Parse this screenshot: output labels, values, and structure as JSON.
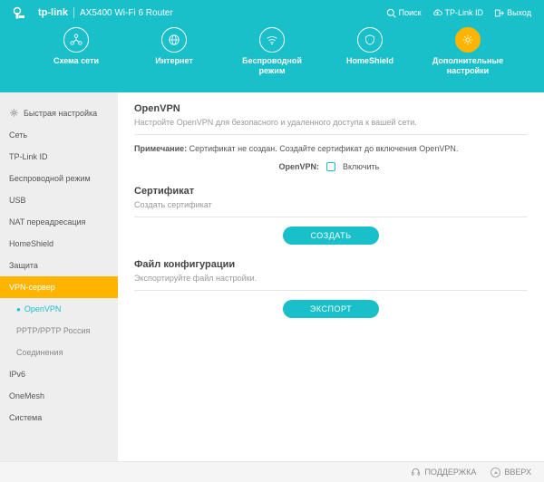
{
  "header": {
    "brand": "tp-link",
    "model": "AX5400 Wi-Fi 6 Router",
    "actions": {
      "search": "Поиск",
      "tplinkid": "TP-Link ID",
      "logout": "Выход"
    }
  },
  "tabs": {
    "diagram": "Схема сети",
    "internet": "Интернет",
    "wireless": "Беспроводной режим",
    "homeshield": "HomeShield",
    "advanced": "Дополнительные настройки"
  },
  "sidebar": {
    "quick": "Быстрая настройка",
    "network": "Сеть",
    "tplinkid": "TP-Link ID",
    "wireless": "Беспроводной режим",
    "usb": "USB",
    "nat": "NAT переадресация",
    "homeshield": "HomeShield",
    "security": "Защита",
    "vpn": "VPN-сервер",
    "vpn_sub": {
      "openvpn": "OpenVPN",
      "pptp": "PPTP/PPTP Россия",
      "conn": "Соединения"
    },
    "ipv6": "IPv6",
    "onemesh": "OneMesh",
    "system": "Система"
  },
  "content": {
    "title": "OpenVPN",
    "desc": "Настройте OpenVPN для безопасного и удаленного доступа к вашей сети.",
    "note_label": "Примечание:",
    "note_text": "Сертификат не создан. Создайте сертификат до включения OpenVPN.",
    "toggle_label": "OpenVPN:",
    "toggle_text": "Включить",
    "cert": {
      "title": "Сертификат",
      "desc": "Создать сертификат",
      "btn": "СОЗДАТЬ"
    },
    "config": {
      "title": "Файл конфигурации",
      "desc": "Экспортируйте файл настройки.",
      "btn": "ЭКСПОРТ"
    }
  },
  "footer": {
    "support": "ПОДДЕРЖКА",
    "top": "ВВЕРХ"
  }
}
